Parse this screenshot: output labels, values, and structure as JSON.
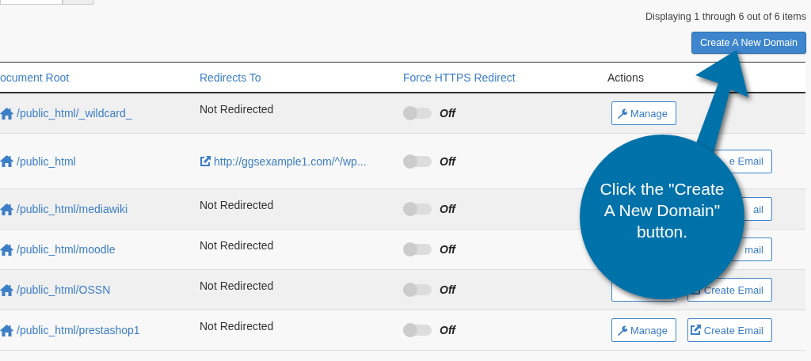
{
  "summary": "Displaying 1 through 6 out of 6 items",
  "create_button": "Create A New Domain",
  "table": {
    "columns": [
      "ocument Root",
      "Redirects To",
      "Force HTTPS Redirect",
      "Actions"
    ],
    "rows": [
      {
        "document_root": "/public_html/_wildcard_",
        "redirect": {
          "kind": "none",
          "text": "Not Redirected"
        },
        "force_https": {
          "on": false,
          "label": "Off"
        },
        "actions": [
          {
            "kind": "manage",
            "label": "Manage"
          }
        ]
      },
      {
        "document_root": "/public_html",
        "redirect": {
          "kind": "link",
          "text": "http://ggsexample1.com/^/wp..."
        },
        "force_https": {
          "on": false,
          "label": "Off"
        },
        "actions": [
          {
            "kind": "hidden"
          },
          {
            "kind": "email",
            "label": "e Email"
          }
        ]
      },
      {
        "document_root": "/public_html/mediawiki",
        "redirect": {
          "kind": "none",
          "text": "Not Redirected"
        },
        "force_https": {
          "on": false,
          "label": "Off"
        },
        "actions": [
          {
            "kind": "hidden"
          },
          {
            "kind": "email",
            "label": "ail"
          }
        ]
      },
      {
        "document_root": "/public_html/moodle",
        "redirect": {
          "kind": "none",
          "text": "Not Redirected"
        },
        "force_https": {
          "on": false,
          "label": "Off"
        },
        "actions": [
          {
            "kind": "hidden"
          },
          {
            "kind": "email",
            "label": "mail"
          }
        ]
      },
      {
        "document_root": "/public_html/OSSN",
        "redirect": {
          "kind": "none",
          "text": "Not Redirected"
        },
        "force_https": {
          "on": false,
          "label": "Off"
        },
        "actions": [
          {
            "kind": "manage"
          },
          {
            "kind": "email",
            "label": "Create Email"
          }
        ]
      },
      {
        "document_root": "/public_html/prestashop1",
        "redirect": {
          "kind": "none",
          "text": "Not Redirected"
        },
        "force_https": {
          "on": false,
          "label": "Off"
        },
        "actions": [
          {
            "kind": "manage",
            "label": "Manage"
          },
          {
            "kind": "email",
            "label": "Create Email"
          }
        ]
      }
    ]
  },
  "callout": {
    "text": "Click the \"Create A New Domain\" button."
  }
}
